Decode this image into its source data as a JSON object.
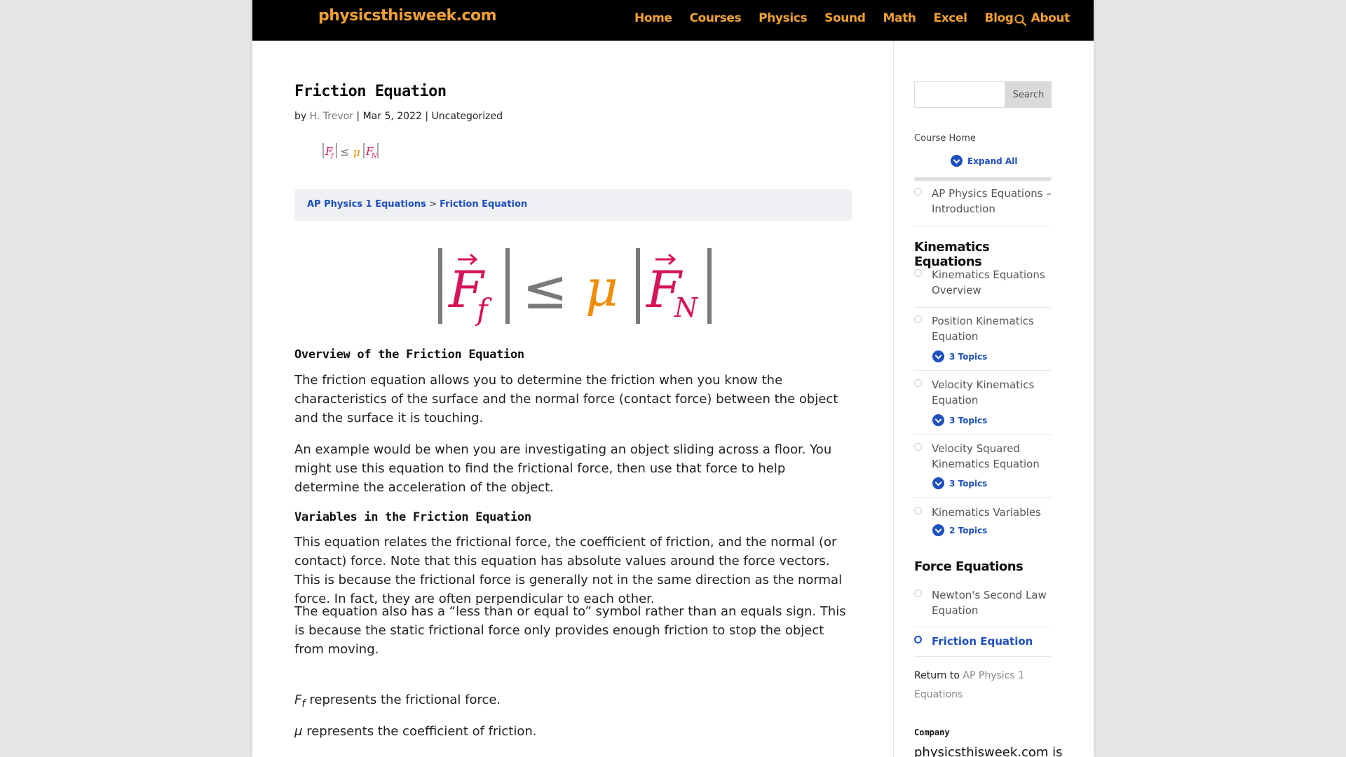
{
  "site": {
    "logo": "physicsthisweek.com",
    "nav": [
      "Home",
      "Courses",
      "Physics",
      "Sound",
      "Math",
      "Excel",
      "Blog",
      "About"
    ]
  },
  "post": {
    "title": "Friction Equation",
    "meta": {
      "by": "by",
      "author": "H. Trevor",
      "date": "Mar 5, 2022",
      "category": "Uncategorized"
    },
    "breadcrumb": {
      "parent": "AP Physics 1 Equations",
      "separator": ">",
      "current": "Friction Equation"
    },
    "equation": {
      "F": "F",
      "f": "f",
      "N": "N",
      "leq": "≤",
      "mu": "μ",
      "colors": {
        "force": "#d6135a",
        "mu": "#f08c00",
        "bars": "#808080"
      }
    },
    "sections": [
      {
        "heading": "Overview of the Friction Equation",
        "paragraphs": [
          "The friction equation allows you to determine the friction when you know the characteristics of the surface and the normal force (contact force) between the object and the surface it is touching.",
          "An example would be when you are investigating an object sliding across a floor.  You might use this equation to find the frictional force, then use that force to help determine the acceleration of the object."
        ]
      },
      {
        "heading": "Variables in the Friction Equation",
        "paragraphs": [
          "This equation relates the frictional force, the coefficient of friction, and the normal (or contact) force.  Note that this equation has absolute values around the force vectors.  This is because the frictional force is generally not in the same direction as the normal force.  In fact, they are often perpendicular to each other.",
          "The equation also has a “less than or equal to” symbol rather than an equals sign.  This is because the static frictional force only provides enough friction to stop the object from moving."
        ]
      }
    ],
    "variables": [
      {
        "symbol": "F",
        "subscript": "f",
        "text": "represents the frictional force."
      },
      {
        "symbol": "μ",
        "subscript": "",
        "text": "represents the coefficient of friction."
      }
    ]
  },
  "sidebar": {
    "search_button": "Search",
    "course_home": "Course Home",
    "expand_all": "Expand All",
    "intro_lesson": "AP Physics Equations – Introduction",
    "sections": [
      {
        "title": "Kinematics Equations",
        "lessons": [
          {
            "label": "Kinematics Equations Overview",
            "topics": ""
          },
          {
            "label": "Position Kinematics Equation",
            "topics": "3 Topics"
          },
          {
            "label": "Velocity Kinematics Equation",
            "topics": "3 Topics"
          },
          {
            "label": "Velocity Squared Kinematics Equation",
            "topics": "3 Topics"
          },
          {
            "label": "Kinematics Variables",
            "topics": "2 Topics"
          }
        ]
      },
      {
        "title": "Force Equations",
        "lessons": [
          {
            "label": "Newton's Second Law Equation",
            "topics": ""
          },
          {
            "label": "Friction Equation",
            "topics": "",
            "active": true
          }
        ]
      }
    ],
    "return_to": "Return to",
    "return_link": "AP Physics 1 Equations",
    "company_heading": "Company",
    "company_text": "physicsthisweek.com is"
  }
}
